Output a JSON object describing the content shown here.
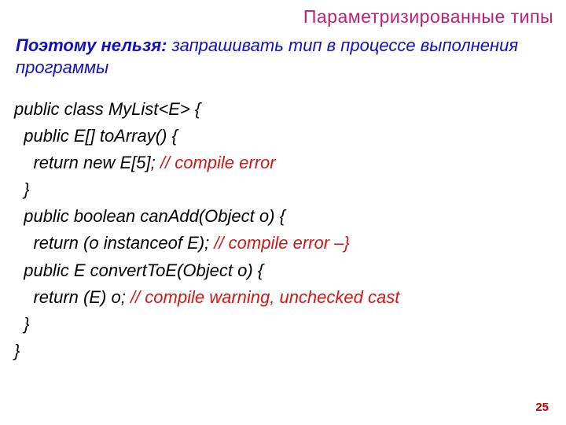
{
  "title": "Параметризированные типы",
  "lead": {
    "strong": "Поэтому нельзя:",
    "rest": " запрашивать тип в процессе выполнения программы"
  },
  "code": {
    "l1": "public class MyList<E> {",
    "l2": "  public E[] toArray() {",
    "l3a": "    return new E[5]; ",
    "l3c": "// compile error",
    "l4": "  }",
    "l5": "  public boolean canAdd(Object o) {",
    "l6a": "    return (o instanceof E); ",
    "l6c": "// compile error –}",
    "l7": "  public E convertToE(Object o) {",
    "l8a": "    return (E) o; ",
    "l8c": "// compile warning, unchecked cast",
    "l9": "  }",
    "l10": "}"
  },
  "page": "25"
}
